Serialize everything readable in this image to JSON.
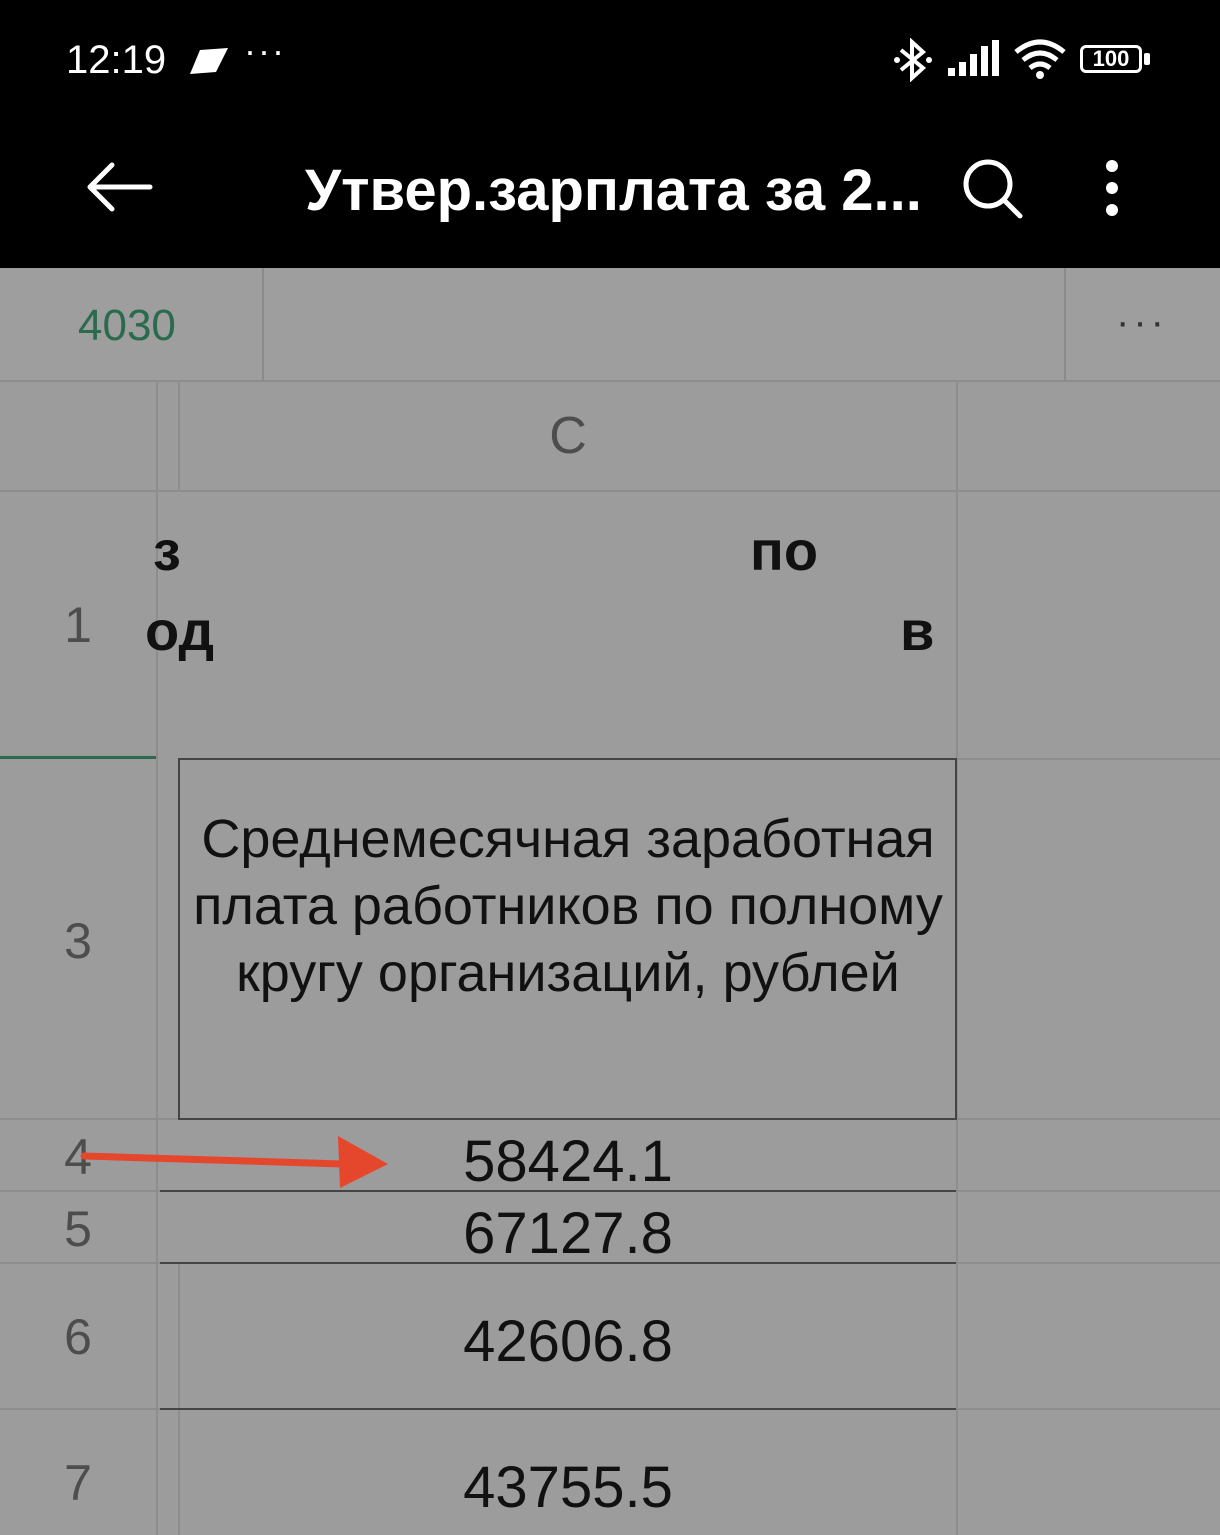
{
  "status": {
    "time": "12:19",
    "dots": "···",
    "battery": "100"
  },
  "app_bar": {
    "title": "Утвер.зарплата за 2..."
  },
  "formula_bar": {
    "cell_ref": "4030",
    "more": "···"
  },
  "sheet": {
    "column_header": "C",
    "rows": [
      {
        "num": "1",
        "fragments": [
          "з",
          "од",
          "по",
          "в"
        ]
      },
      {
        "num": "3",
        "text": "Среднемесячная заработная плата работников по полному кругу организаций, рублей"
      },
      {
        "num": "4",
        "value": "58424.1"
      },
      {
        "num": "5",
        "value": "67127.8"
      },
      {
        "num": "6",
        "value": "42606.8"
      },
      {
        "num": "7",
        "value": "43755.5"
      }
    ]
  },
  "colors": {
    "accent_green": "#2a6b4d",
    "annotation_arrow": "#e5472d"
  }
}
